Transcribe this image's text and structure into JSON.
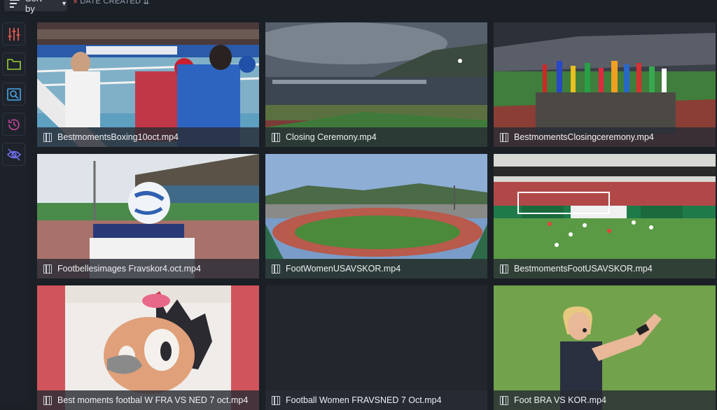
{
  "toolbar": {
    "sort_label": "Sort by",
    "sort_field": "DATE CREATED",
    "remove_symbol": "×",
    "order_symbol": "⇊"
  },
  "sidebar": {
    "items": [
      {
        "icon": "sliders-icon",
        "accent": "#e2584f"
      },
      {
        "icon": "folder-icon",
        "accent": "#9acd3a"
      },
      {
        "icon": "image-search-icon",
        "accent": "#4aa8e8"
      },
      {
        "icon": "history-icon",
        "accent": "#c8479b"
      },
      {
        "icon": "hidden-icon",
        "accent": "#6f6ce8"
      }
    ]
  },
  "media": {
    "items": [
      {
        "filename": "BestmomentsBoxing10oct.mp4"
      },
      {
        "filename": "Closing Ceremony.mp4"
      },
      {
        "filename": "BestmomentsClosingceremony.mp4"
      },
      {
        "filename": "Footbellesimages Fravskor4.oct.mp4"
      },
      {
        "filename": "FootWomenUSAVSKOR.mp4"
      },
      {
        "filename": "BestmomentsFootUSAVSKOR.mp4"
      },
      {
        "filename": "Best moments footbal W FRA VS NED 7 oct.mp4"
      },
      {
        "filename": "Football Women FRAVSNED 7 Oct.mp4"
      },
      {
        "filename": "Foot BRA VS KOR.mp4"
      }
    ]
  }
}
